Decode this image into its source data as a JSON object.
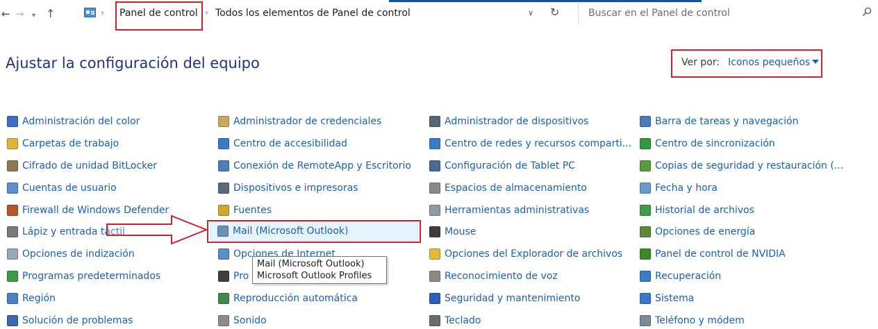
{
  "nav": {
    "breadcrumb": [
      "Panel de control",
      "Todos los elementos de Panel de control"
    ],
    "search_placeholder": "Buscar en el Panel de control"
  },
  "header": {
    "title": "Ajustar la configuración del equipo",
    "view_label": "Ver por:",
    "view_value": "Iconos pequeños"
  },
  "columns": [
    [
      {
        "label": "Administración del color",
        "icon": "color-management-icon",
        "color": "#3b6fc4"
      },
      {
        "label": "Carpetas de trabajo",
        "icon": "work-folders-icon",
        "color": "#e3b23c"
      },
      {
        "label": "Cifrado de unidad BitLocker",
        "icon": "bitlocker-icon",
        "color": "#8a7a52"
      },
      {
        "label": "Cuentas de usuario",
        "icon": "user-accounts-icon",
        "color": "#5a8fd0"
      },
      {
        "label": "Firewall de Windows Defender",
        "icon": "firewall-icon",
        "color": "#b4552a"
      },
      {
        "label": "Lápiz y entrada táctil",
        "icon": "pen-touch-icon",
        "color": "#7a7a7a"
      },
      {
        "label": "Opciones de indización",
        "icon": "indexing-icon",
        "color": "#9aa7b8"
      },
      {
        "label": "Programas predeterminados",
        "icon": "default-programs-icon",
        "color": "#3a9c4a"
      },
      {
        "label": "Región",
        "icon": "region-icon",
        "color": "#4d7fc8"
      },
      {
        "label": "Solución de problemas",
        "icon": "troubleshooting-icon",
        "color": "#3c6ab0"
      }
    ],
    [
      {
        "label": "Administrador de credenciales",
        "icon": "credential-manager-icon",
        "color": "#c9a75c"
      },
      {
        "label": "Centro de accesibilidad",
        "icon": "accessibility-icon",
        "color": "#3a78c8"
      },
      {
        "label": "Conexión de RemoteApp y Escritorio",
        "icon": "remoteapp-icon",
        "color": "#4b7fba"
      },
      {
        "label": "Dispositivos e impresoras",
        "icon": "devices-printers-icon",
        "color": "#5b6a7a"
      },
      {
        "label": "Fuentes",
        "icon": "fonts-icon",
        "color": "#d4a62a"
      },
      {
        "label": "Mail (Microsoft Outlook)",
        "icon": "mail-outlook-icon",
        "color": "#6a8fb8"
      },
      {
        "label": "Opciones de Internet",
        "icon": "internet-options-icon",
        "color": "#5d8ec9"
      },
      {
        "label": "Programas y características",
        "display": "Pro",
        "icon": "programs-features-icon",
        "color": "#3f3f3f"
      },
      {
        "label": "Reproducción automática",
        "icon": "autoplay-icon",
        "color": "#3d8c4a"
      },
      {
        "label": "Sonido",
        "icon": "sound-icon",
        "color": "#8c8c8c"
      }
    ],
    [
      {
        "label": "Administrador de dispositivos",
        "icon": "device-manager-icon",
        "color": "#5a6675"
      },
      {
        "label": "Centro de redes y recursos comparti...",
        "icon": "network-center-icon",
        "color": "#3b7bc8"
      },
      {
        "label": "Configuración de Tablet PC",
        "icon": "tablet-pc-icon",
        "color": "#4a6a94"
      },
      {
        "label": "Espacios de almacenamiento",
        "icon": "storage-spaces-icon",
        "color": "#8a8a8a"
      },
      {
        "label": "Herramientas administrativas",
        "icon": "admin-tools-icon",
        "color": "#8f9aa8"
      },
      {
        "label": "Mouse",
        "icon": "mouse-icon",
        "color": "#3c3c3c"
      },
      {
        "label": "Opciones del Explorador de archivos",
        "icon": "file-explorer-options-icon",
        "color": "#e8b83c"
      },
      {
        "label": "Reconocimiento de voz",
        "icon": "speech-recognition-icon",
        "color": "#8a8a8a"
      },
      {
        "label": "Seguridad y mantenimiento",
        "icon": "security-maintenance-icon",
        "color": "#2a5fb8"
      },
      {
        "label": "Teclado",
        "icon": "keyboard-icon",
        "color": "#6c6c6c"
      }
    ],
    [
      {
        "label": "Barra de tareas y navegación",
        "icon": "taskbar-icon",
        "color": "#4a7db8"
      },
      {
        "label": "Centro de sincronización",
        "icon": "sync-center-icon",
        "color": "#2f9a3e"
      },
      {
        "label": "Copias de seguridad y restauración (...",
        "icon": "backup-restore-icon",
        "color": "#5a9a3e"
      },
      {
        "label": "Fecha y hora",
        "icon": "date-time-icon",
        "color": "#6a9ad0"
      },
      {
        "label": "Historial de archivos",
        "icon": "file-history-icon",
        "color": "#3f9a4a"
      },
      {
        "label": "Opciones de energía",
        "icon": "power-options-icon",
        "color": "#5a8a3a"
      },
      {
        "label": "Panel de control de NVIDIA",
        "icon": "nvidia-icon",
        "color": "#3a8a2a"
      },
      {
        "label": "Recuperación",
        "icon": "recovery-icon",
        "color": "#3a7ac8"
      },
      {
        "label": "Sistema",
        "icon": "system-icon",
        "color": "#3a78c8"
      },
      {
        "label": "Teléfono y módem",
        "icon": "phone-modem-icon",
        "color": "#7a8a9a"
      }
    ]
  ],
  "tooltip": {
    "line1": "Mail (Microsoft Outlook)",
    "line2": "Microsoft Outlook Profiles"
  },
  "colors": {
    "link": "#1a5fb4",
    "title": "#1e3287",
    "annotation_red": "#d3212d",
    "selected_bg": "#e5f3ff"
  }
}
